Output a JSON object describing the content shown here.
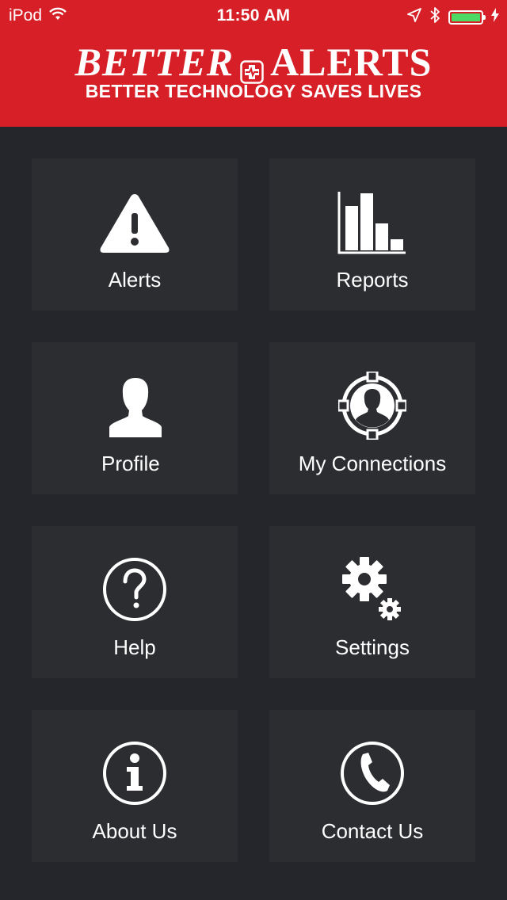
{
  "status_bar": {
    "carrier": "iPod",
    "time": "11:50 AM",
    "battery_level": 1.0,
    "battery_color": "#4cd964"
  },
  "header": {
    "background": "#d61f26",
    "brand_word_1": "BETTER",
    "brand_word_2": "ALERTS",
    "tagline": "BETTER TECHNOLOGY SAVES LIVES"
  },
  "menu": {
    "items": [
      {
        "label": "Alerts",
        "icon": "warning-icon"
      },
      {
        "label": "Reports",
        "icon": "bar-chart-icon"
      },
      {
        "label": "Profile",
        "icon": "person-silhouette-icon"
      },
      {
        "label": "My Connections",
        "icon": "connections-icon"
      },
      {
        "label": "Help",
        "icon": "question-circle-icon"
      },
      {
        "label": "Settings",
        "icon": "gears-icon"
      },
      {
        "label": "About Us",
        "icon": "info-circle-icon"
      },
      {
        "label": "Contact Us",
        "icon": "phone-circle-icon"
      }
    ]
  }
}
